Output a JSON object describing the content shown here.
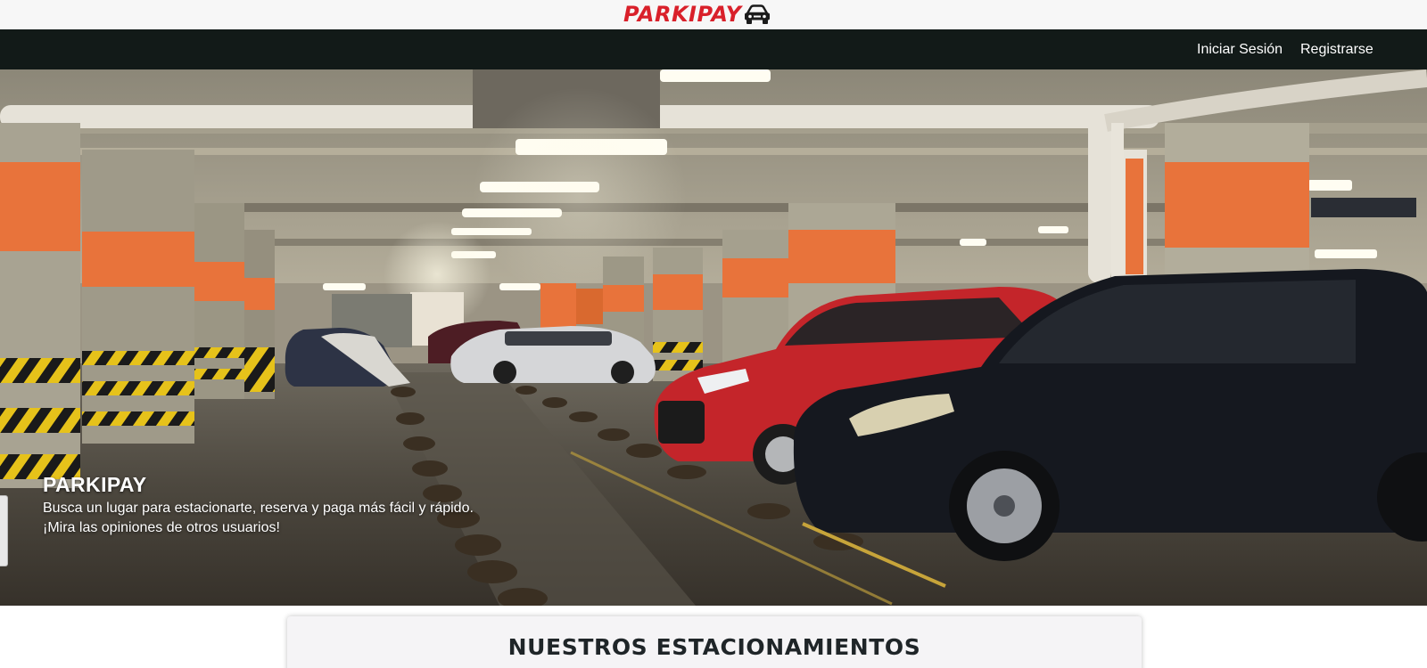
{
  "brand": {
    "name": "PARKIPAY",
    "color": "#d9202a",
    "icon": "car-icon"
  },
  "nav": {
    "login_label": "Iniciar Sesión",
    "register_label": "Registrarse",
    "background": "#121a18"
  },
  "hero": {
    "title": "PARKIPAY",
    "line1": "Busca un lugar para estacionarte, reserva y paga más fácil y rápido.",
    "line2": "¡Mira las opiniones de otros usuarios!",
    "image_subject": "underground parking garage with parked cars"
  },
  "section": {
    "title": "NUESTROS ESTACIONAMIENTOS"
  }
}
